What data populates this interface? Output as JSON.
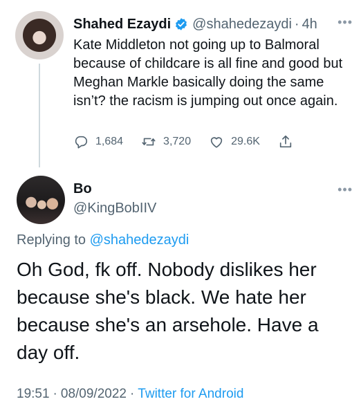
{
  "parent_tweet": {
    "name": "Shahed Ezaydi",
    "handle": "@shahedezaydi",
    "separator": "·",
    "time": "4h",
    "text": "Kate Middleton not going up to Balmoral because of childcare is all fine and good but Meghan Markle basically doing the same isn’t? the racism is jumping out once again.",
    "replies": "1,684",
    "retweets": "3,720",
    "likes": "29.6K",
    "icons": [
      "verified-badge-icon",
      "reply-icon",
      "retweet-icon",
      "like-icon",
      "share-icon",
      "more-icon"
    ]
  },
  "reply_tweet": {
    "name": "Bo",
    "handle": "@KingBobIIV",
    "replying_prefix": "Replying to",
    "replying_to": "@shahedezaydi",
    "text": "Oh God, fk off. Nobody dislikes her because she's black. We hate her because she's an arsehole. Have a day off.",
    "time": "19:51",
    "date": "08/09/2022",
    "separator": "·",
    "source": "Twitter for Android"
  },
  "colors": {
    "text": "#0f1419",
    "secondary": "#536471",
    "link": "#1d9bf0",
    "thread_line": "#cfd9de"
  }
}
